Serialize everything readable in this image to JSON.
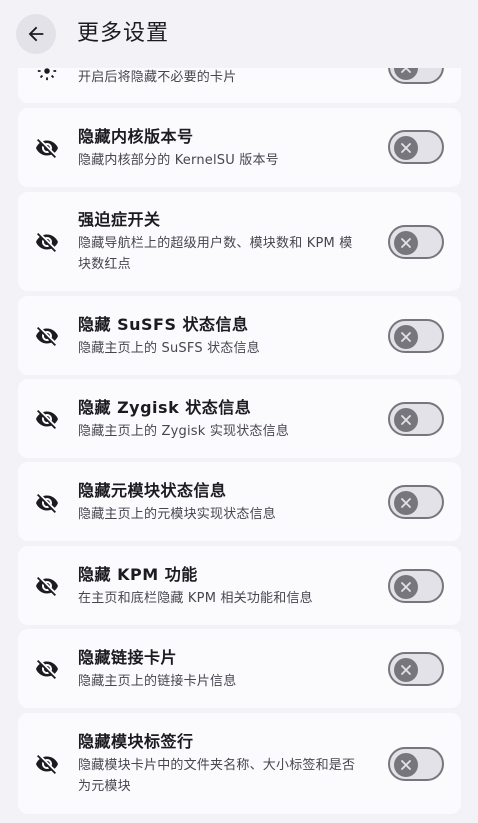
{
  "header": {
    "title": "更多设置",
    "back_icon": "arrow-left-icon"
  },
  "colors": {
    "background": "#f3f2f7",
    "card": "#fbfbfd",
    "switch_off_track": "#e3e2e8",
    "switch_off_thumb": "#77767d"
  },
  "settings": [
    {
      "title": "",
      "description": "开启后将隐藏不必要的卡片",
      "icon": "settings-icon",
      "enabled": false
    },
    {
      "title": "隐藏内核版本号",
      "description": "隐藏内核部分的 KernelSU 版本号",
      "icon": "visibility-off-icon",
      "enabled": false
    },
    {
      "title": "强迫症开关",
      "description": "隐藏导航栏上的超级用户数、模块数和 KPM 模块数红点",
      "icon": "visibility-off-icon",
      "enabled": false
    },
    {
      "title": "隐藏 SuSFS 状态信息",
      "description": "隐藏主页上的 SuSFS 状态信息",
      "icon": "visibility-off-icon",
      "enabled": false
    },
    {
      "title": "隐藏 Zygisk 状态信息",
      "description": "隐藏主页上的 Zygisk 实现状态信息",
      "icon": "visibility-off-icon",
      "enabled": false
    },
    {
      "title": "隐藏元模块状态信息",
      "description": "隐藏主页上的元模块实现状态信息",
      "icon": "visibility-off-icon",
      "enabled": false
    },
    {
      "title": "隐藏 KPM 功能",
      "description": "在主页和底栏隐藏 KPM 相关功能和信息",
      "icon": "visibility-off-icon",
      "enabled": false
    },
    {
      "title": "隐藏链接卡片",
      "description": "隐藏主页上的链接卡片信息",
      "icon": "visibility-off-icon",
      "enabled": false
    },
    {
      "title": "隐藏模块标签行",
      "description": "隐藏模块卡片中的文件夹名称、大小标签和是否为元模块",
      "icon": "visibility-off-icon",
      "enabled": false
    }
  ]
}
